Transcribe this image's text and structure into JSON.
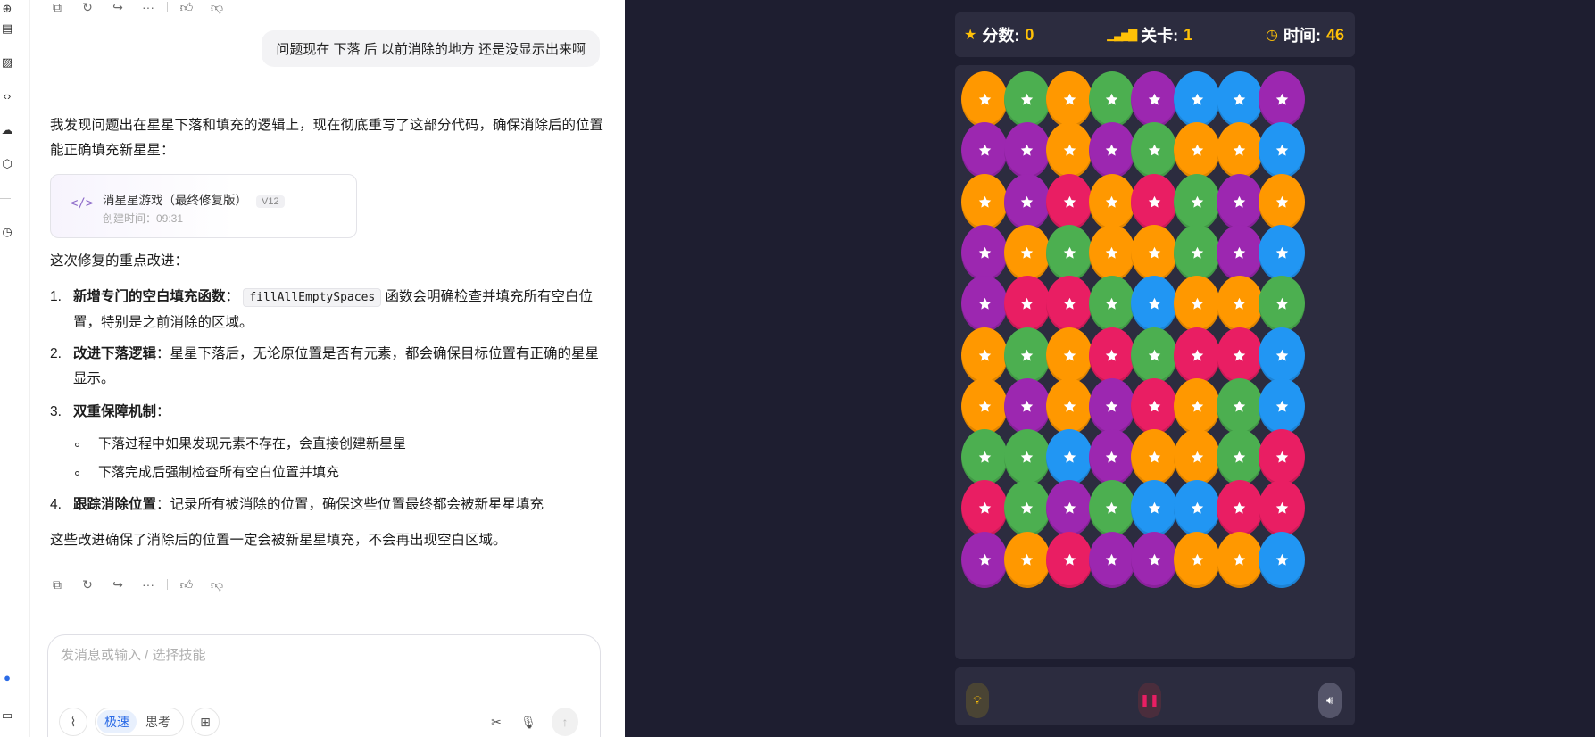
{
  "chat": {
    "user_message": "问题现在 下落 后 以前消除的地方  还是没显示出来啊",
    "intro": "我发现问题出在星星下落和填充的逻辑上，现在彻底重写了这部分代码，确保消除后的位置能正确填充新星星：",
    "artifact": {
      "title": "消星星游戏（最终修复版）",
      "version": "V12",
      "created": "创建时间：09:31",
      "icon": "code-icon"
    },
    "improvements_heading": "这次修复的重点改进：",
    "items": [
      {
        "num": "1.",
        "bold": "新增专门的空白填充函数",
        "sep": "：",
        "code": "fillAllEmptySpaces",
        "rest": " 函数会明确检查并填充所有空白位置，特别是之前消除的区域。"
      },
      {
        "num": "2.",
        "bold": "改进下落逻辑",
        "sep": "：",
        "rest": "星星下落后，无论原位置是否有元素，都会确保目标位置有正确的星星显示。"
      },
      {
        "num": "3.",
        "bold": "双重保障机制",
        "sep": "：",
        "rest": ""
      },
      {
        "num": "4.",
        "bold": "跟踪消除位置",
        "sep": "：",
        "rest": "记录所有被消除的位置，确保这些位置最终都会被新星星填充"
      }
    ],
    "sub_bullets": [
      "下落过程中如果发现元素不存在，会直接创建新星星",
      "下落完成后强制检查所有空白位置并填充"
    ],
    "conclusion": "这些改进确保了消除后的位置一定会被新星星填充，不会再出现空白区域。",
    "input_placeholder": "发消息或输入 / 选择技能",
    "modes": [
      "极速",
      "思考"
    ]
  },
  "game": {
    "score_label": "分数:",
    "score": "0",
    "level_label": "关卡:",
    "level": "1",
    "time_label": "时间:",
    "time": "46",
    "colors": {
      "O": "#ff9800",
      "G": "#4caf50",
      "P": "#9c27b0",
      "B": "#2196f3",
      "R": "#e91e63"
    },
    "grid": [
      [
        "O",
        "G",
        "O",
        "G",
        "P",
        "B",
        "B",
        "P"
      ],
      [
        "P",
        "P",
        "O",
        "P",
        "G",
        "O",
        "O",
        "B"
      ],
      [
        "O",
        "P",
        "R",
        "O",
        "R",
        "G",
        "P",
        "O"
      ],
      [
        "P",
        "O",
        "G",
        "O",
        "O",
        "G",
        "P",
        "B"
      ],
      [
        "P",
        "R",
        "R",
        "G",
        "B",
        "O",
        "O",
        "G"
      ],
      [
        "O",
        "G",
        "O",
        "R",
        "G",
        "R",
        "R",
        "B"
      ],
      [
        "O",
        "P",
        "O",
        "P",
        "R",
        "O",
        "G",
        "B"
      ],
      [
        "G",
        "G",
        "B",
        "P",
        "O",
        "O",
        "G",
        "R"
      ],
      [
        "R",
        "G",
        "P",
        "G",
        "B",
        "B",
        "R",
        "R"
      ],
      [
        "P",
        "O",
        "R",
        "P",
        "P",
        "O",
        "O",
        "B"
      ]
    ]
  }
}
